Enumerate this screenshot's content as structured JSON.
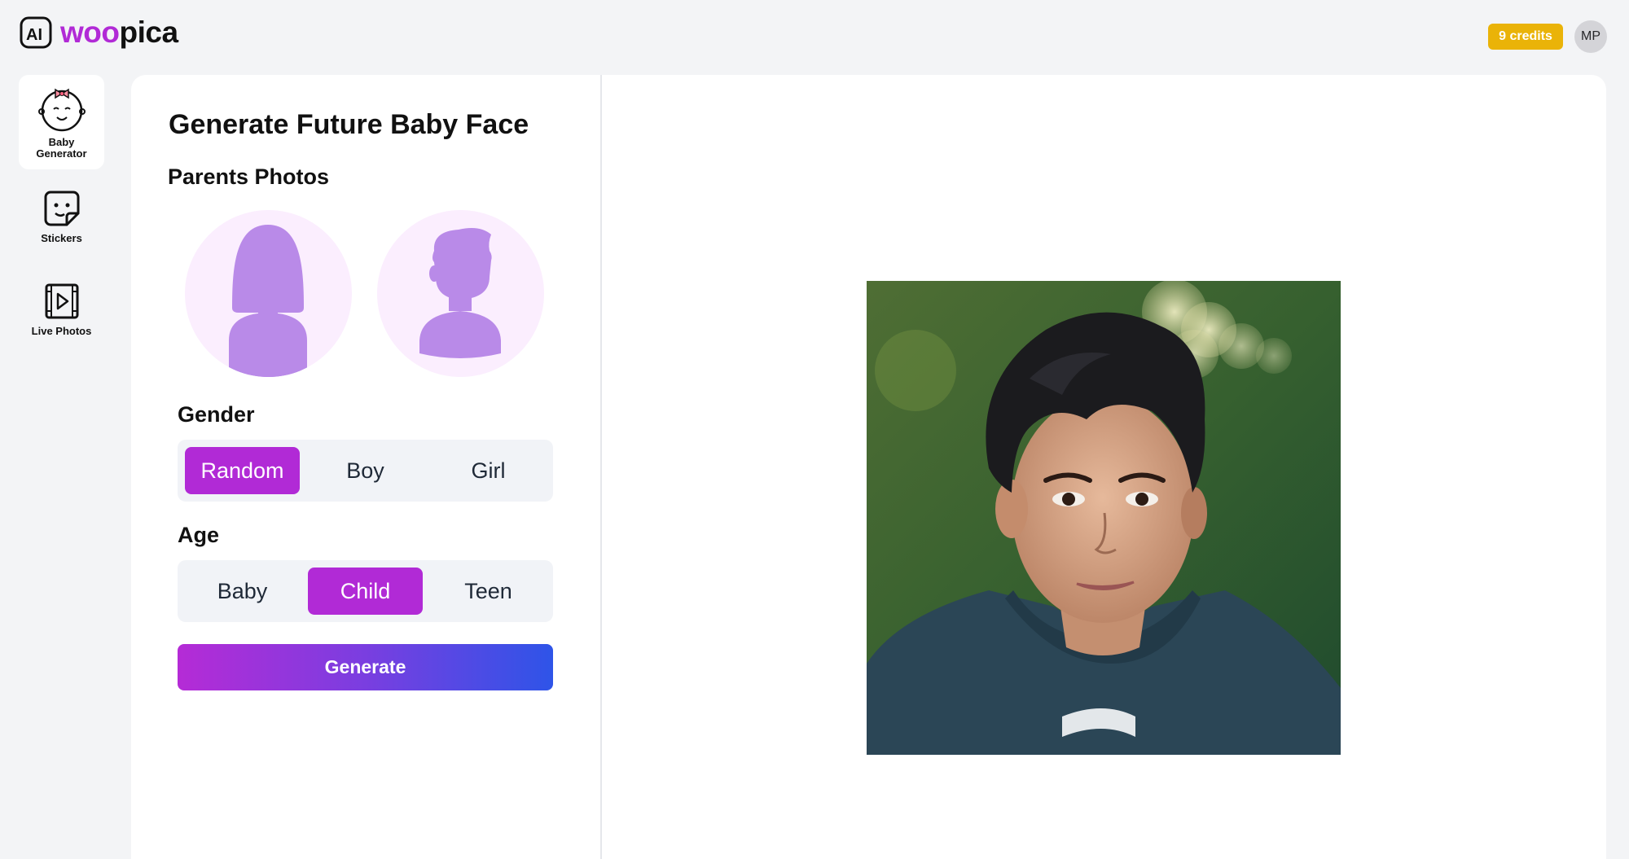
{
  "header": {
    "logo_mark": "AI",
    "brand_accent": "woo",
    "brand_rest": "pica",
    "credits": "9 credits",
    "avatar_initials": "MP"
  },
  "nav": {
    "items": [
      {
        "label_line1": "Baby",
        "label_line2": "Generator",
        "icon": "baby-face-icon",
        "active": true
      },
      {
        "label": "Stickers",
        "icon": "sticker-icon",
        "active": false
      },
      {
        "label": "Live Photos",
        "icon": "video-play-icon",
        "active": false
      }
    ]
  },
  "main": {
    "title": "Generate Future Baby Face",
    "parents_label": "Parents Photos",
    "gender": {
      "label": "Gender",
      "options": [
        "Random",
        "Boy",
        "Girl"
      ],
      "selected": "Random"
    },
    "age": {
      "label": "Age",
      "options": [
        "Baby",
        "Child",
        "Teen"
      ],
      "selected": "Child"
    },
    "generate_label": "Generate"
  },
  "colors": {
    "brand_purple": "#b12ad6",
    "credits_badge": "#eab308",
    "silhouette": "#b98ae8",
    "silhouette_bg": "#fbeefe",
    "gradient_start": "#b52bd6",
    "gradient_end": "#2e54e8"
  }
}
